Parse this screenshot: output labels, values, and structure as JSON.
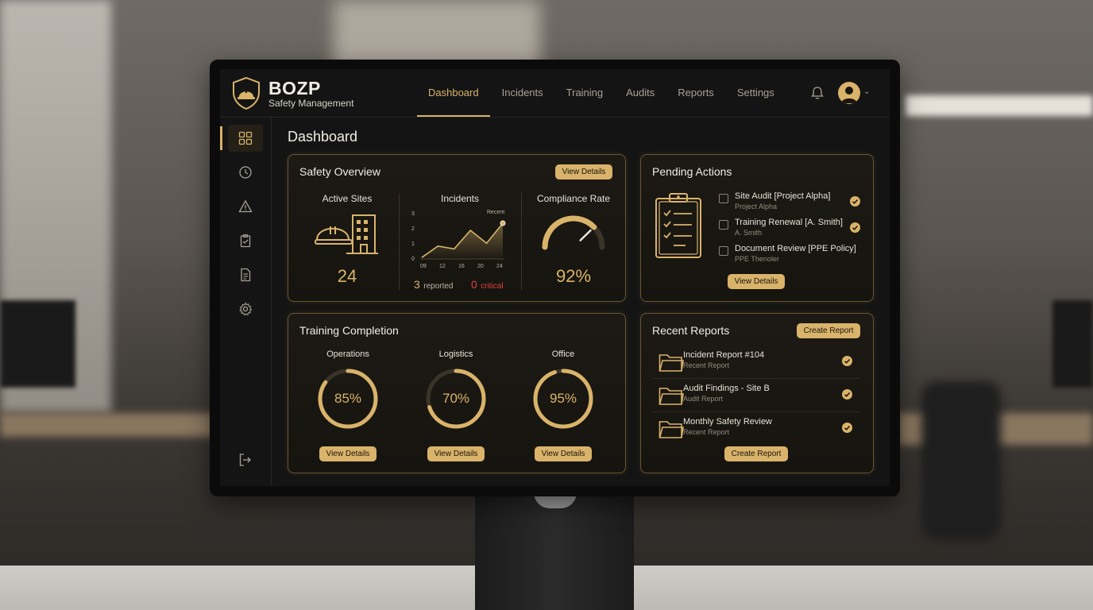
{
  "header": {
    "brand": "BOZP",
    "brand_sub": "Safety Management",
    "nav": [
      "Dashboard",
      "Incidents",
      "Training",
      "Audits",
      "Reports",
      "Settings"
    ]
  },
  "page_title": "Dashboard",
  "safety_overview": {
    "title": "Safety Overview",
    "button": "View Details",
    "active_sites": {
      "label": "Active Sites",
      "value": "24"
    },
    "incidents": {
      "label": "Incidents",
      "y_ticks": [
        "3",
        "2",
        "1",
        "0"
      ],
      "x_ticks": [
        "09",
        "12",
        "16",
        "20",
        "24"
      ],
      "recent_label": "Recent",
      "values": [
        0.1,
        0.9,
        0.7,
        2.0,
        1.1,
        2.5
      ],
      "reported_count": "3",
      "reported_label": "reported",
      "critical_count": "0",
      "critical_label": "critical"
    },
    "compliance": {
      "label": "Compliance Rate",
      "value": "92%",
      "fraction": 0.92
    }
  },
  "pending_actions": {
    "title": "Pending Actions",
    "items": [
      {
        "title": "Site Audit [Project Alpha]",
        "sub": "Project Alpha"
      },
      {
        "title": "Training Renewal [A. Smith]",
        "sub": "A. Smith"
      },
      {
        "title": "Document Review [PPE Policy]",
        "sub": "PPE Thenoler"
      }
    ],
    "button": "View Details"
  },
  "training": {
    "title": "Training Completion",
    "groups": [
      {
        "label": "Operations",
        "value": "85%",
        "fraction": 0.85,
        "button": "View Details"
      },
      {
        "label": "Logistics",
        "value": "70%",
        "fraction": 0.7,
        "button": "View Details"
      },
      {
        "label": "Office",
        "value": "95%",
        "fraction": 0.95,
        "button": "View Details"
      }
    ]
  },
  "recent_reports": {
    "title": "Recent Reports",
    "top_button": "Create Report",
    "items": [
      {
        "title": "Incident Report #104",
        "sub": "Recent Report"
      },
      {
        "title": "Audit Findings - Site B",
        "sub": "Audit Report"
      },
      {
        "title": "Monthly Safety Review",
        "sub": "Recent Report"
      }
    ],
    "bottom_button": "Create Report"
  },
  "colors": {
    "accent": "#d9b36a",
    "critical": "#e0413a",
    "card_bg": "#1d1a15"
  }
}
